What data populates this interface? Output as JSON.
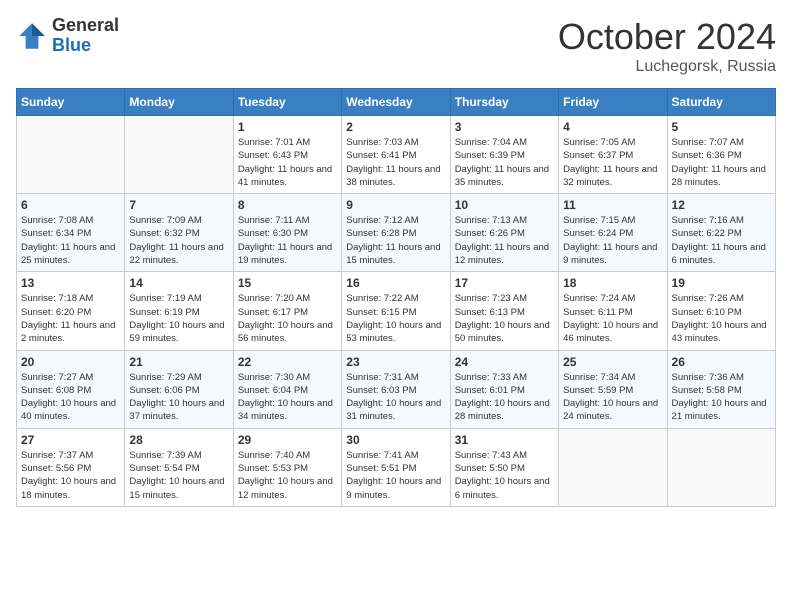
{
  "header": {
    "logo_general": "General",
    "logo_blue": "Blue",
    "month": "October 2024",
    "location": "Luchegorsk, Russia"
  },
  "weekdays": [
    "Sunday",
    "Monday",
    "Tuesday",
    "Wednesday",
    "Thursday",
    "Friday",
    "Saturday"
  ],
  "weeks": [
    [
      {
        "day": "",
        "info": ""
      },
      {
        "day": "",
        "info": ""
      },
      {
        "day": "1",
        "info": "Sunrise: 7:01 AM\nSunset: 6:43 PM\nDaylight: 11 hours and 41 minutes."
      },
      {
        "day": "2",
        "info": "Sunrise: 7:03 AM\nSunset: 6:41 PM\nDaylight: 11 hours and 38 minutes."
      },
      {
        "day": "3",
        "info": "Sunrise: 7:04 AM\nSunset: 6:39 PM\nDaylight: 11 hours and 35 minutes."
      },
      {
        "day": "4",
        "info": "Sunrise: 7:05 AM\nSunset: 6:37 PM\nDaylight: 11 hours and 32 minutes."
      },
      {
        "day": "5",
        "info": "Sunrise: 7:07 AM\nSunset: 6:36 PM\nDaylight: 11 hours and 28 minutes."
      }
    ],
    [
      {
        "day": "6",
        "info": "Sunrise: 7:08 AM\nSunset: 6:34 PM\nDaylight: 11 hours and 25 minutes."
      },
      {
        "day": "7",
        "info": "Sunrise: 7:09 AM\nSunset: 6:32 PM\nDaylight: 11 hours and 22 minutes."
      },
      {
        "day": "8",
        "info": "Sunrise: 7:11 AM\nSunset: 6:30 PM\nDaylight: 11 hours and 19 minutes."
      },
      {
        "day": "9",
        "info": "Sunrise: 7:12 AM\nSunset: 6:28 PM\nDaylight: 11 hours and 15 minutes."
      },
      {
        "day": "10",
        "info": "Sunrise: 7:13 AM\nSunset: 6:26 PM\nDaylight: 11 hours and 12 minutes."
      },
      {
        "day": "11",
        "info": "Sunrise: 7:15 AM\nSunset: 6:24 PM\nDaylight: 11 hours and 9 minutes."
      },
      {
        "day": "12",
        "info": "Sunrise: 7:16 AM\nSunset: 6:22 PM\nDaylight: 11 hours and 6 minutes."
      }
    ],
    [
      {
        "day": "13",
        "info": "Sunrise: 7:18 AM\nSunset: 6:20 PM\nDaylight: 11 hours and 2 minutes."
      },
      {
        "day": "14",
        "info": "Sunrise: 7:19 AM\nSunset: 6:19 PM\nDaylight: 10 hours and 59 minutes."
      },
      {
        "day": "15",
        "info": "Sunrise: 7:20 AM\nSunset: 6:17 PM\nDaylight: 10 hours and 56 minutes."
      },
      {
        "day": "16",
        "info": "Sunrise: 7:22 AM\nSunset: 6:15 PM\nDaylight: 10 hours and 53 minutes."
      },
      {
        "day": "17",
        "info": "Sunrise: 7:23 AM\nSunset: 6:13 PM\nDaylight: 10 hours and 50 minutes."
      },
      {
        "day": "18",
        "info": "Sunrise: 7:24 AM\nSunset: 6:11 PM\nDaylight: 10 hours and 46 minutes."
      },
      {
        "day": "19",
        "info": "Sunrise: 7:26 AM\nSunset: 6:10 PM\nDaylight: 10 hours and 43 minutes."
      }
    ],
    [
      {
        "day": "20",
        "info": "Sunrise: 7:27 AM\nSunset: 6:08 PM\nDaylight: 10 hours and 40 minutes."
      },
      {
        "day": "21",
        "info": "Sunrise: 7:29 AM\nSunset: 6:06 PM\nDaylight: 10 hours and 37 minutes."
      },
      {
        "day": "22",
        "info": "Sunrise: 7:30 AM\nSunset: 6:04 PM\nDaylight: 10 hours and 34 minutes."
      },
      {
        "day": "23",
        "info": "Sunrise: 7:31 AM\nSunset: 6:03 PM\nDaylight: 10 hours and 31 minutes."
      },
      {
        "day": "24",
        "info": "Sunrise: 7:33 AM\nSunset: 6:01 PM\nDaylight: 10 hours and 28 minutes."
      },
      {
        "day": "25",
        "info": "Sunrise: 7:34 AM\nSunset: 5:59 PM\nDaylight: 10 hours and 24 minutes."
      },
      {
        "day": "26",
        "info": "Sunrise: 7:36 AM\nSunset: 5:58 PM\nDaylight: 10 hours and 21 minutes."
      }
    ],
    [
      {
        "day": "27",
        "info": "Sunrise: 7:37 AM\nSunset: 5:56 PM\nDaylight: 10 hours and 18 minutes."
      },
      {
        "day": "28",
        "info": "Sunrise: 7:39 AM\nSunset: 5:54 PM\nDaylight: 10 hours and 15 minutes."
      },
      {
        "day": "29",
        "info": "Sunrise: 7:40 AM\nSunset: 5:53 PM\nDaylight: 10 hours and 12 minutes."
      },
      {
        "day": "30",
        "info": "Sunrise: 7:41 AM\nSunset: 5:51 PM\nDaylight: 10 hours and 9 minutes."
      },
      {
        "day": "31",
        "info": "Sunrise: 7:43 AM\nSunset: 5:50 PM\nDaylight: 10 hours and 6 minutes."
      },
      {
        "day": "",
        "info": ""
      },
      {
        "day": "",
        "info": ""
      }
    ]
  ]
}
